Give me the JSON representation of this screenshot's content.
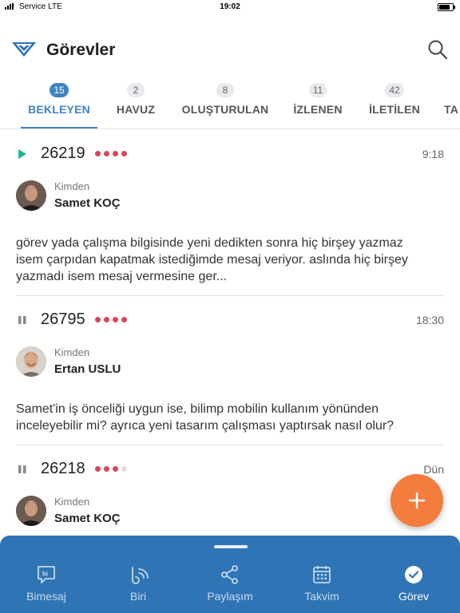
{
  "status_bar": {
    "carrier": "Service  LTE",
    "time": "19:02"
  },
  "header": {
    "title": "Görevler",
    "logo_icon": "app-logo-icon",
    "search_icon": "search-icon"
  },
  "tabs": [
    {
      "count": "15",
      "label": "BEKLEYEN",
      "active": true
    },
    {
      "count": "2",
      "label": "HAVUZ"
    },
    {
      "count": "8",
      "label": "OLUŞTURULAN"
    },
    {
      "count": "11",
      "label": "İZLENEN"
    },
    {
      "count": "42",
      "label": "İLETİLEN"
    },
    {
      "count": "",
      "label": "TA"
    }
  ],
  "tasks": [
    {
      "id": "26219",
      "state": "play-icon",
      "priority": 4,
      "priority_max": 4,
      "time": "9:18",
      "from_label": "Kimden",
      "from_name": "Samet KOÇ",
      "message": "görev yada çalışma bilgisinde yeni dedikten sonra hiç birşey yazmaz isem çarpıdan kapatmak istediğimde mesaj veriyor. aslında hiç birşey yazmadı isem mesaj vermesine ger..."
    },
    {
      "id": "26795",
      "state": "pause-icon",
      "priority": 4,
      "priority_max": 4,
      "time": "18:30",
      "from_label": "Kimden",
      "from_name": "Ertan USLU",
      "message": "Samet'in iş önceliği uygun ise, bilimp mobilin kullanım yönünden inceleyebilir mi? ayrıca yeni tasarım çalışması yaptırsak nasıl olur?"
    },
    {
      "id": "26218",
      "state": "pause-icon",
      "priority": 3,
      "priority_max": 4,
      "time": "Dün",
      "from_label": "Kimden",
      "from_name": "Samet KOÇ",
      "message": ""
    }
  ],
  "fab": {
    "icon": "plus-icon"
  },
  "bottom_nav": [
    {
      "label": "Bimesaj",
      "icon": "chat-bubble-icon"
    },
    {
      "label": "Biri",
      "icon": "biri-icon"
    },
    {
      "label": "Paylaşım",
      "icon": "share-icon"
    },
    {
      "label": "Takvim",
      "icon": "calendar-icon"
    },
    {
      "label": "Görev",
      "icon": "check-circle-icon",
      "active": true
    }
  ],
  "colors": {
    "accent": "#3e84c4",
    "nav_bg": "#2f74b5",
    "fab": "#f47c3c",
    "priority": "#d8465b",
    "play": "#1fb69a"
  }
}
